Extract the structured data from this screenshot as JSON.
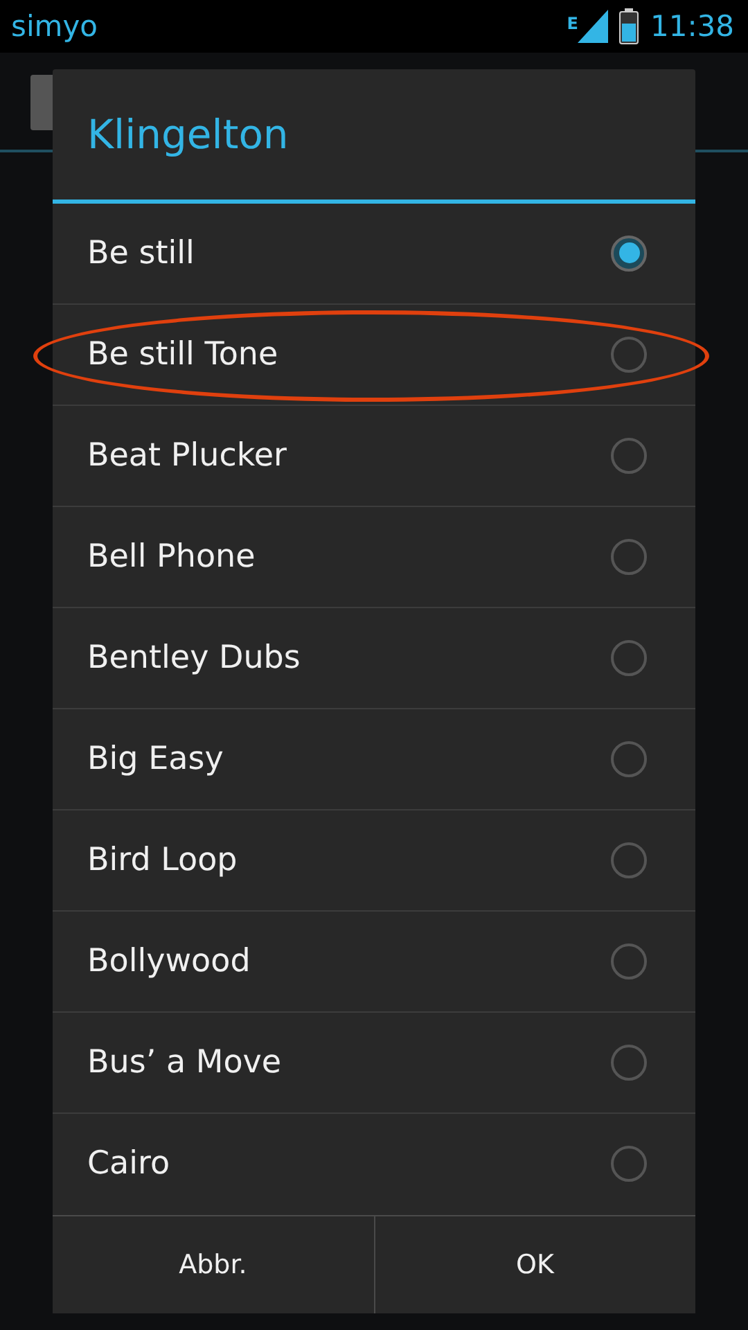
{
  "status_bar": {
    "carrier": "simyo",
    "network": "E",
    "time": "11:38"
  },
  "dialog": {
    "title": "Klingelton",
    "items": [
      {
        "label": "Be still",
        "selected": true,
        "circled": false
      },
      {
        "label": "Be still Tone",
        "selected": false,
        "circled": true
      },
      {
        "label": "Beat Plucker",
        "selected": false,
        "circled": false
      },
      {
        "label": "Bell Phone",
        "selected": false,
        "circled": false
      },
      {
        "label": "Bentley Dubs",
        "selected": false,
        "circled": false
      },
      {
        "label": "Big Easy",
        "selected": false,
        "circled": false
      },
      {
        "label": "Bird Loop",
        "selected": false,
        "circled": false
      },
      {
        "label": "Bollywood",
        "selected": false,
        "circled": false
      },
      {
        "label": "Bus’ a Move",
        "selected": false,
        "circled": false
      },
      {
        "label": "Cairo",
        "selected": false,
        "circled": false
      }
    ],
    "buttons": [
      "Abbr.",
      "OK"
    ]
  }
}
